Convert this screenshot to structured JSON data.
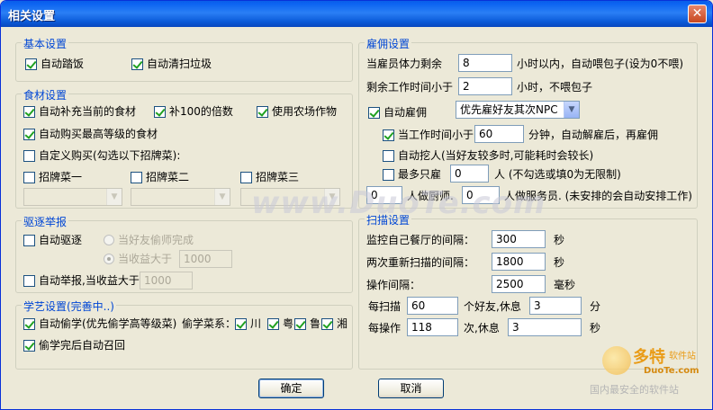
{
  "window": {
    "title": "相关设置",
    "close": "✕"
  },
  "basic": {
    "legend": "基本设置",
    "auto_kick": "自动踏饭",
    "auto_clean": "自动清扫垃圾"
  },
  "ingredients": {
    "legend": "食材设置",
    "auto_refill": "自动补充当前的食材",
    "multiple_100": "补100的倍数",
    "use_farm": "使用农场作物",
    "auto_buy_best": "自动购买最高等级的食材",
    "custom_buy": "自定义购买(勾选以下招牌菜):",
    "dish1": "招牌菜一",
    "dish2": "招牌菜二",
    "dish3": "招牌菜三"
  },
  "expel": {
    "legend": "驱逐举报",
    "auto_expel": "自动驱逐",
    "when_friend_done": "当好友偷师完成",
    "when_profit_gt": "当收益大于",
    "profit_value": "1000",
    "auto_report": "自动举报,当收益大于",
    "report_value": "1000"
  },
  "learn": {
    "legend": "学艺设置(完善中..)",
    "auto_learn": "自动偷学(优先偷学高等级菜)",
    "cuisine_label": "偷学菜系：",
    "cuisine_chuan": "川",
    "cuisine_yue": "粤",
    "cuisine_lu": "鲁",
    "cuisine_xiang": "湘",
    "auto_recall": "偷学完后自动召回"
  },
  "hire": {
    "legend": "雇佣设置",
    "stamina_label": "当雇员体力剩余",
    "stamina_value": "8",
    "stamina_suffix": "小时以内，自动喂包子(设为0不喂)",
    "work_label": "剩余工作时间小于",
    "work_value": "2",
    "work_suffix": "小时，不喂包子",
    "auto_hire": "自动雇佣",
    "hire_option": "优先雇好友其次NPC",
    "when_work_lt": "当工作时间小于",
    "when_work_value": "60",
    "when_work_suffix": "分钟，自动解雇后，再雇佣",
    "auto_poach": "自动挖人(当好友较多时,可能耗时会较长)",
    "max_hire": "最多只雇",
    "max_hire_value": "0",
    "max_hire_suffix": "人  (不勾选或填0为无限制)",
    "chef_value": "0",
    "chef_label": "人做厨师.",
    "waiter_value": "0",
    "waiter_label": "人做服务员. (未安排的会自动安排工作)"
  },
  "scan": {
    "legend": "扫描设置",
    "monitor_label": "监控自己餐厅的间隔：",
    "monitor_value": "300",
    "monitor_unit": "秒",
    "rescan_label": "两次重新扫描的间隔：",
    "rescan_value": "1800",
    "rescan_unit": "秒",
    "op_label": "操作间隔：",
    "op_value": "2500",
    "op_unit": "毫秒",
    "per_scan_label": "每扫描",
    "per_scan_value": "60",
    "per_scan_mid": "个好友,休息",
    "per_scan_rest": "3",
    "per_scan_unit": "分",
    "per_op_label": "每操作",
    "per_op_value": "118",
    "per_op_mid": "次,休息",
    "per_op_rest": "3",
    "per_op_unit": "秒"
  },
  "footer": {
    "ok": "确定",
    "cancel": "取消"
  },
  "watermark": {
    "text": "www.DuoTe.com",
    "logo_big": "多特",
    "logo_sm": "软件站",
    "logo_url": "DuoTe.com",
    "logo_tag": "国内最安全的软件站"
  },
  "colors": {
    "titlebar": "#0b5ad8",
    "legend": "#0046d5",
    "face": "#ece9d8",
    "check": "#21a121"
  }
}
